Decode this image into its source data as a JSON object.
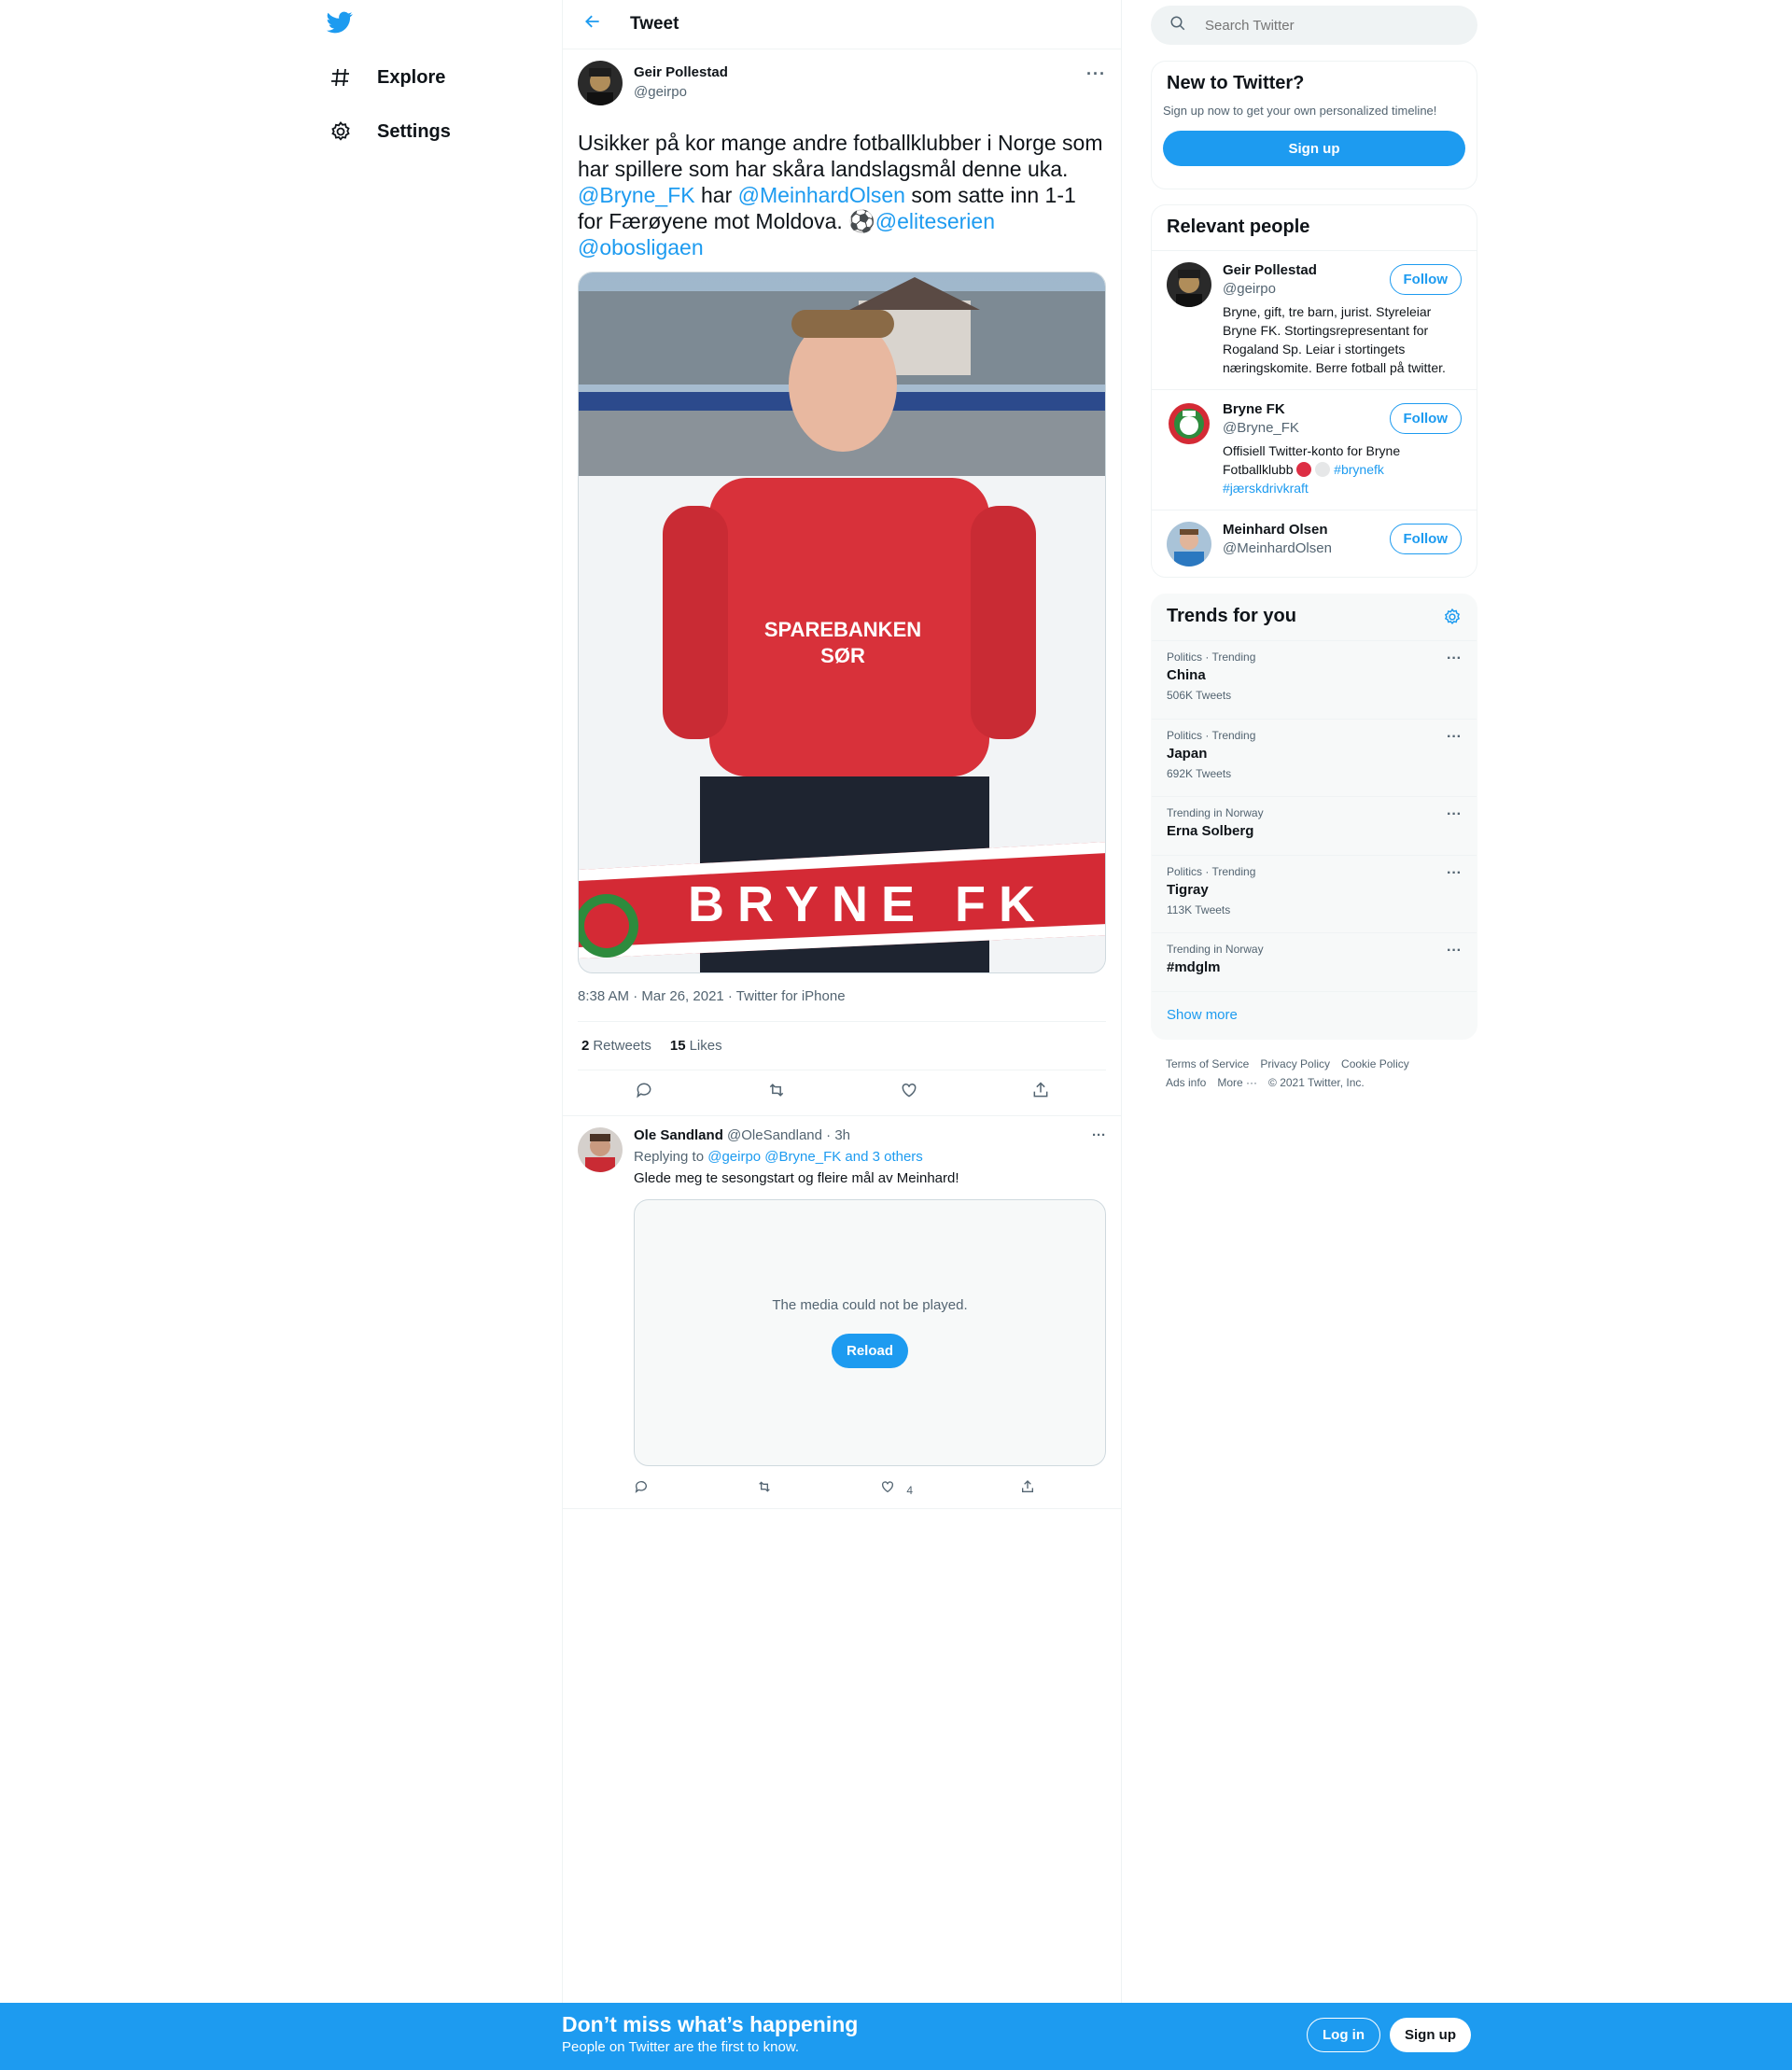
{
  "nav": {
    "items": [
      {
        "label": "Explore",
        "icon": "hash-icon"
      },
      {
        "label": "Settings",
        "icon": "gear-icon"
      }
    ]
  },
  "header": {
    "title": "Tweet"
  },
  "tweet": {
    "author_name": "Geir Pollestad",
    "author_handle": "@geirpo",
    "text_part1": "Usikker på kor mange andre fotballklubber i Norge som har spillere som har skåra landslagsmål denne uka. ",
    "mention1": "@Bryne_FK",
    "text_part2": " har ",
    "mention2": "@MeinhardOlsen",
    "text_part3": " som satte inn 1-1 for Færøyene mot Moldova. ⚽",
    "mention3": "@eliteserien",
    "mention4": "@obosligaen",
    "image_scarf_text": "BRYNE FK",
    "image_sponsor1": "SPAREBANKEN",
    "image_sponsor2": "SØR",
    "timestamp": "8:38 AM · Mar 26, 2021 · Twitter for iPhone",
    "retweets": "2",
    "retweets_label": "Retweets",
    "likes": "15",
    "likes_label": "Likes"
  },
  "reply": {
    "name": "Ole Sandland",
    "handle_time": "@OleSandland · 3h",
    "replying_prefix": "Replying to ",
    "replying_to": "@geirpo @Bryne_FK and 3 others",
    "text": "Glede meg te sesongstart og fleire mål av Meinhard!",
    "media_message": "The media could not be played.",
    "reload_label": "Reload",
    "like_count": "4"
  },
  "search": {
    "placeholder": "Search Twitter"
  },
  "new_to_twitter": {
    "title": "New to Twitter?",
    "subtitle": "Sign up now to get your own personalized timeline!",
    "button": "Sign up"
  },
  "relevant_people": {
    "title": "Relevant people",
    "follow_label": "Follow",
    "people": [
      {
        "name": "Geir Pollestad",
        "handle": "@geirpo",
        "bio": "Bryne, gift, tre barn, jurist. Styreleiar Bryne FK. Stortingsrepresentant for Rogaland Sp. Leiar i stortingets næringskomite. Berre fotball på twitter."
      },
      {
        "name": "Bryne FK",
        "handle": "@Bryne_FK",
        "bio": "Offisiell Twitter-konto for Bryne Fotballklubb ",
        "hashtag1": "#brynefk",
        "hashtag2": "#jærskdrivkraft"
      },
      {
        "name": "Meinhard Olsen",
        "handle": "@MeinhardOlsen"
      }
    ]
  },
  "trends": {
    "title": "Trends for you",
    "items": [
      {
        "context": "Politics · Trending",
        "name": "China",
        "count": "506K Tweets"
      },
      {
        "context": "Politics · Trending",
        "name": "Japan",
        "count": "692K Tweets"
      },
      {
        "context": "Trending in Norway",
        "name": "Erna Solberg",
        "count": ""
      },
      {
        "context": "Politics · Trending",
        "name": "Tigray",
        "count": "113K Tweets"
      },
      {
        "context": "Trending in Norway",
        "name": "#mdglm",
        "count": ""
      }
    ],
    "show_more": "Show more"
  },
  "footer": {
    "links": [
      "Terms of Service",
      "Privacy Policy",
      "Cookie Policy",
      "Ads info",
      "More ···"
    ],
    "copyright": "© 2021 Twitter, Inc."
  },
  "bottom_bar": {
    "headline": "Don’t miss what’s happening",
    "subline": "People on Twitter are the first to know.",
    "login": "Log in",
    "signup": "Sign up"
  },
  "colors": {
    "accent": "#1d9bf0",
    "text": "#0f1419",
    "muted": "#536471"
  }
}
